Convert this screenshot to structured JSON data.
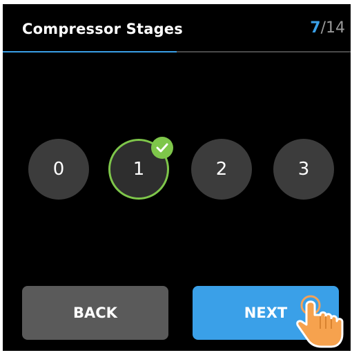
{
  "header": {
    "title": "Compressor Stages",
    "step_current": "7",
    "step_total": "/14",
    "progress": 0.5
  },
  "options": [
    {
      "label": "0",
      "selected": false
    },
    {
      "label": "1",
      "selected": true
    },
    {
      "label": "2",
      "selected": false
    },
    {
      "label": "3",
      "selected": false
    }
  ],
  "buttons": {
    "back_label": "BACK",
    "next_label": "NEXT"
  },
  "icons": {
    "check": "checkmark-icon",
    "pointer": "hand-pointer-icon"
  },
  "colors": {
    "accent": "#3aa0e8",
    "selected": "#7ec64a",
    "option_bg": "#3c3c3c",
    "back_bg": "#5a5a5a"
  }
}
